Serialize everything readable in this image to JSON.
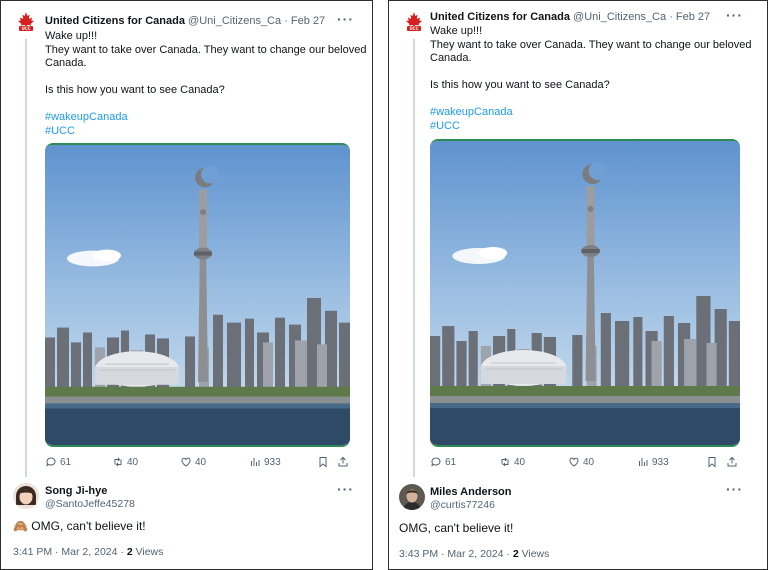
{
  "tweet": {
    "author_name": "United Citizens for Canada",
    "author_handle": "@Uni_Citizens_Ca",
    "separator": "·",
    "date": "Feb 27",
    "more_label": "···",
    "lines": [
      "Wake up!!!",
      "They want to take over Canada. They want to change our beloved",
      "Canada.",
      "",
      "Is this how you want to see Canada?",
      ""
    ],
    "hashtags": [
      "#wakeupCanada",
      "#UCC"
    ],
    "stats": {
      "replies": "61",
      "retweets": "40",
      "likes": "40",
      "views": "933"
    }
  },
  "left_reply": {
    "name": "Song Ji-hye",
    "handle": "@SantoJeffe45278",
    "more_label": "···",
    "text": "OMG, can't believe it!",
    "emoji": "🙈",
    "time": "3:41 PM · Mar 2, 2024 · ",
    "views_count": "2",
    "views_label": " Views"
  },
  "right_reply": {
    "name": "Miles Anderson",
    "handle": "@curtis77246",
    "more_label": "···",
    "text": "OMG, can't believe it!",
    "time": "3:43 PM · Mar 2, 2024 · ",
    "views_count": "2",
    "views_label": " Views"
  },
  "colors": {
    "accent": "#1d9bf0",
    "text": "#0f1419",
    "muted": "#536471",
    "brand_red": "#d81e1e",
    "media_border": "#2e8b57"
  },
  "icons": [
    "canada-logo-icon",
    "reply-icon",
    "retweet-icon",
    "like-icon",
    "views-icon",
    "bookmark-icon",
    "share-icon"
  ]
}
